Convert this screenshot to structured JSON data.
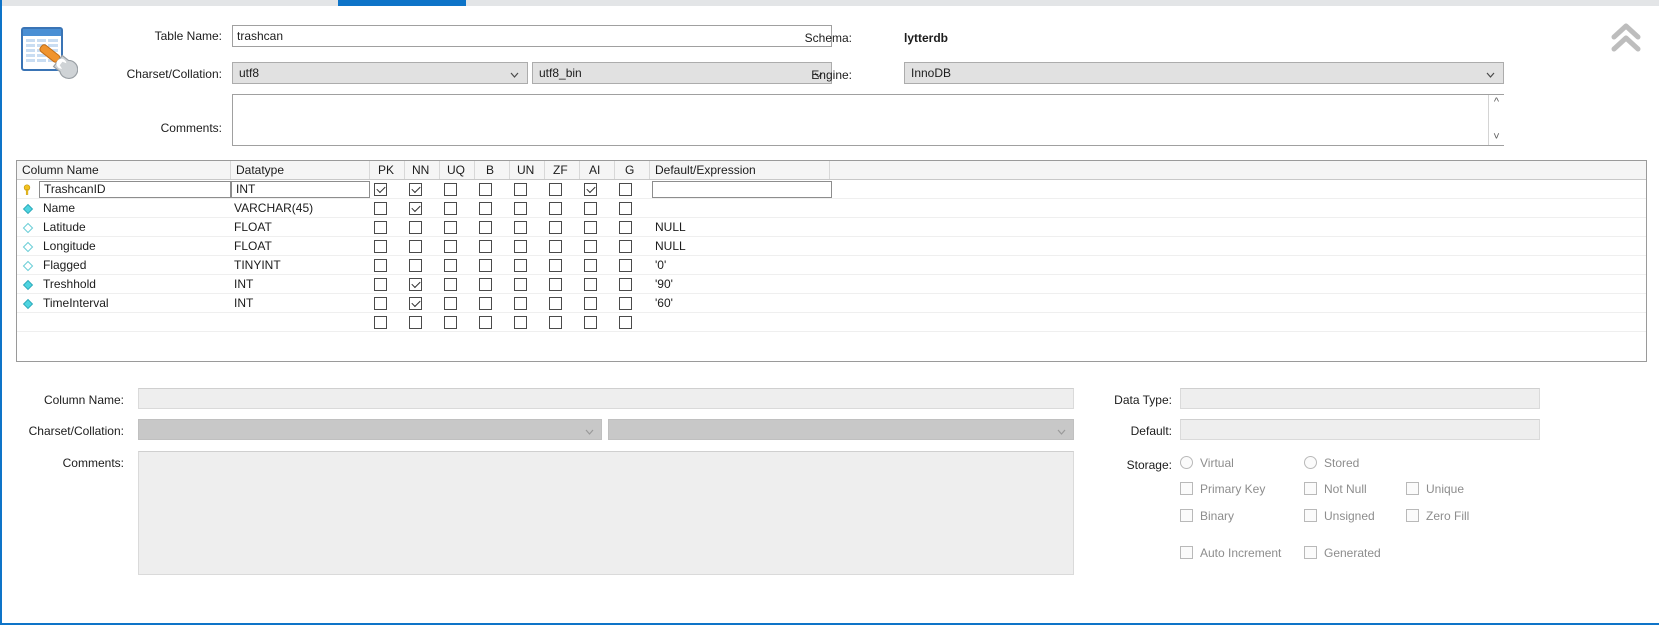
{
  "window": {
    "collapse_icon": "double-chevron-up-icon",
    "table_icon": "table-edit-icon"
  },
  "tabs": {
    "active_index": 1,
    "items": [
      {
        "label": "",
        "active": false
      },
      {
        "label": "",
        "active": true
      },
      {
        "label": "",
        "active": false
      }
    ]
  },
  "header": {
    "table_name_label": "Table Name:",
    "table_name_value": "trashcan",
    "schema_label": "Schema:",
    "schema_value": "lytterdb",
    "charset_label": "Charset/Collation:",
    "charset_value": "utf8",
    "collation_value": "utf8_bin",
    "engine_label": "Engine:",
    "engine_value": "InnoDB",
    "comments_label": "Comments:",
    "comments_value": ""
  },
  "columns_grid": {
    "headers": [
      "Column Name",
      "Datatype",
      "PK",
      "NN",
      "UQ",
      "B",
      "UN",
      "ZF",
      "AI",
      "G",
      "Default/Expression"
    ],
    "rows": [
      {
        "icon": "primary-key-icon",
        "name": "TrashcanID",
        "datatype": "INT",
        "pk": true,
        "nn": true,
        "uq": false,
        "b": false,
        "un": false,
        "zf": false,
        "ai": true,
        "g": false,
        "default": "",
        "editing": true
      },
      {
        "icon": "column-filled-icon",
        "name": "Name",
        "datatype": "VARCHAR(45)",
        "pk": false,
        "nn": true,
        "uq": false,
        "b": false,
        "un": false,
        "zf": false,
        "ai": false,
        "g": false,
        "default": "",
        "editing": false
      },
      {
        "icon": "column-hollow-icon",
        "name": "Latitude",
        "datatype": "FLOAT",
        "pk": false,
        "nn": false,
        "uq": false,
        "b": false,
        "un": false,
        "zf": false,
        "ai": false,
        "g": false,
        "default": "NULL",
        "editing": false
      },
      {
        "icon": "column-hollow-icon",
        "name": "Longitude",
        "datatype": "FLOAT",
        "pk": false,
        "nn": false,
        "uq": false,
        "b": false,
        "un": false,
        "zf": false,
        "ai": false,
        "g": false,
        "default": "NULL",
        "editing": false
      },
      {
        "icon": "column-hollow-icon",
        "name": "Flagged",
        "datatype": "TINYINT",
        "pk": false,
        "nn": false,
        "uq": false,
        "b": false,
        "un": false,
        "zf": false,
        "ai": false,
        "g": false,
        "default": "'0'",
        "editing": false
      },
      {
        "icon": "column-filled-icon",
        "name": "Treshhold",
        "datatype": "INT",
        "pk": false,
        "nn": true,
        "uq": false,
        "b": false,
        "un": false,
        "zf": false,
        "ai": false,
        "g": false,
        "default": "'90'",
        "editing": false
      },
      {
        "icon": "column-filled-icon",
        "name": "TimeInterval",
        "datatype": "INT",
        "pk": false,
        "nn": true,
        "uq": false,
        "b": false,
        "un": false,
        "zf": false,
        "ai": false,
        "g": false,
        "default": "'60'",
        "editing": false
      },
      {
        "icon": "",
        "name": "",
        "datatype": "",
        "pk": false,
        "nn": false,
        "uq": false,
        "b": false,
        "un": false,
        "zf": false,
        "ai": false,
        "g": false,
        "default": "",
        "editing": false
      }
    ]
  },
  "detail": {
    "column_name_label": "Column Name:",
    "column_name_value": "",
    "charset_label": "Charset/Collation:",
    "charset_value": "",
    "collation_value": "",
    "comments_label": "Comments:",
    "comments_value": "",
    "data_type_label": "Data Type:",
    "data_type_value": "",
    "default_label": "Default:",
    "default_value": "",
    "storage_label": "Storage:",
    "radios": [
      {
        "label": "Virtual",
        "checked": false
      },
      {
        "label": "Stored",
        "checked": false
      }
    ],
    "checkboxes": [
      {
        "label": "Primary Key",
        "checked": false
      },
      {
        "label": "Not Null",
        "checked": false
      },
      {
        "label": "Unique",
        "checked": false
      },
      {
        "label": "Binary",
        "checked": false
      },
      {
        "label": "Unsigned",
        "checked": false
      },
      {
        "label": "Zero Fill",
        "checked": false
      },
      {
        "label": "Auto Increment",
        "checked": false
      },
      {
        "label": "Generated",
        "checked": false
      }
    ]
  },
  "colors": {
    "accent": "#0e74c8",
    "key_icon": "#f3c220",
    "column_icon": "#4fd4e0",
    "text": "#1c1c1c",
    "disabled_text": "#8d8d8d"
  }
}
